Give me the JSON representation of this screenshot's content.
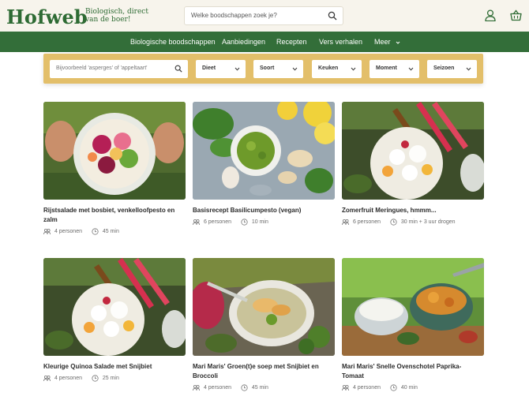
{
  "brand": {
    "logo": "Hofweb",
    "tagline": "Biologisch, direct van de boer!"
  },
  "search": {
    "placeholder": "Welke boodschappen zoek je?"
  },
  "nav": [
    {
      "label": "Biologische boodschappen"
    },
    {
      "label": "Aanbiedingen"
    },
    {
      "label": "Recepten"
    },
    {
      "label": "Vers verhalen"
    },
    {
      "label": "Meer"
    }
  ],
  "filters": {
    "search_placeholder": "Bijvoorbeeld 'asperges' of 'appeltaart'",
    "selects": [
      {
        "label": "Dieet"
      },
      {
        "label": "Soort"
      },
      {
        "label": "Keuken"
      },
      {
        "label": "Moment"
      },
      {
        "label": "Seizoen"
      }
    ]
  },
  "recipes": [
    {
      "title": "Rijstsalade met bosbiet, venkelloofpesto en zalm",
      "persons": "4 personen",
      "time": "45 min"
    },
    {
      "title": "Basisrecept Basilicumpesto (vegan)",
      "persons": "6 personen",
      "time": "10 min"
    },
    {
      "title": "Zomerfruit Meringues, hmmm...",
      "persons": "6 personen",
      "time": "30 min + 3 uur drogen"
    },
    {
      "title": "Kleurige Quinoa Salade met Snijbiet",
      "persons": "4 personen",
      "time": "25 min"
    },
    {
      "title": "Mari Maris' Groen(t)e soep met Snijbiet en Broccoli",
      "persons": "4 personen",
      "time": "45 min"
    },
    {
      "title": "Mari Maris' Snelle Ovenschotel Paprika-Tomaat",
      "persons": "4 personen",
      "time": "40 min"
    }
  ],
  "colors": {
    "brand_green": "#336e39",
    "filter_bar": "#e3bf6a",
    "header_bg": "#f7f4ec"
  }
}
